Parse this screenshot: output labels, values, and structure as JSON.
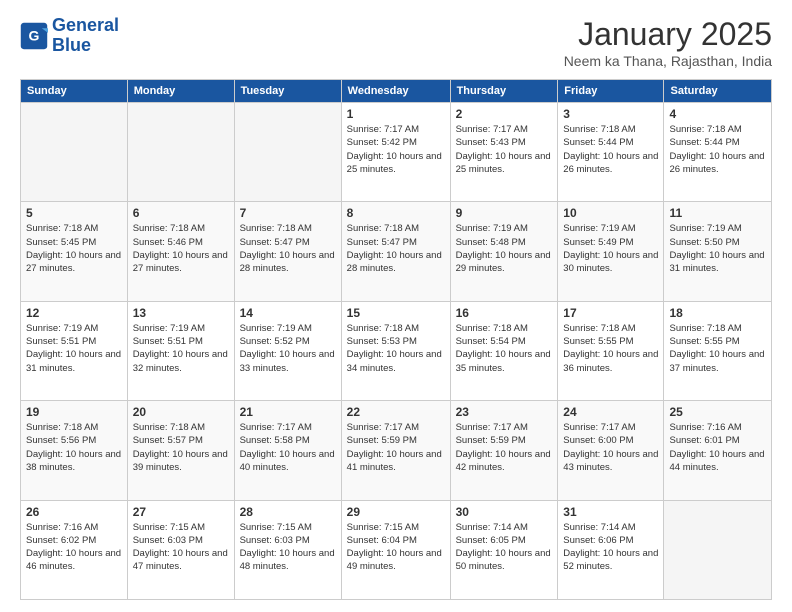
{
  "header": {
    "logo_line1": "General",
    "logo_line2": "Blue",
    "month": "January 2025",
    "location": "Neem ka Thana, Rajasthan, India"
  },
  "weekdays": [
    "Sunday",
    "Monday",
    "Tuesday",
    "Wednesday",
    "Thursday",
    "Friday",
    "Saturday"
  ],
  "weeks": [
    [
      {
        "day": "",
        "sunrise": "",
        "sunset": "",
        "daylight": ""
      },
      {
        "day": "",
        "sunrise": "",
        "sunset": "",
        "daylight": ""
      },
      {
        "day": "",
        "sunrise": "",
        "sunset": "",
        "daylight": ""
      },
      {
        "day": "1",
        "sunrise": "7:17 AM",
        "sunset": "5:42 PM",
        "daylight": "10 hours and 25 minutes."
      },
      {
        "day": "2",
        "sunrise": "7:17 AM",
        "sunset": "5:43 PM",
        "daylight": "10 hours and 25 minutes."
      },
      {
        "day": "3",
        "sunrise": "7:18 AM",
        "sunset": "5:44 PM",
        "daylight": "10 hours and 26 minutes."
      },
      {
        "day": "4",
        "sunrise": "7:18 AM",
        "sunset": "5:44 PM",
        "daylight": "10 hours and 26 minutes."
      }
    ],
    [
      {
        "day": "5",
        "sunrise": "7:18 AM",
        "sunset": "5:45 PM",
        "daylight": "10 hours and 27 minutes."
      },
      {
        "day": "6",
        "sunrise": "7:18 AM",
        "sunset": "5:46 PM",
        "daylight": "10 hours and 27 minutes."
      },
      {
        "day": "7",
        "sunrise": "7:18 AM",
        "sunset": "5:47 PM",
        "daylight": "10 hours and 28 minutes."
      },
      {
        "day": "8",
        "sunrise": "7:18 AM",
        "sunset": "5:47 PM",
        "daylight": "10 hours and 28 minutes."
      },
      {
        "day": "9",
        "sunrise": "7:19 AM",
        "sunset": "5:48 PM",
        "daylight": "10 hours and 29 minutes."
      },
      {
        "day": "10",
        "sunrise": "7:19 AM",
        "sunset": "5:49 PM",
        "daylight": "10 hours and 30 minutes."
      },
      {
        "day": "11",
        "sunrise": "7:19 AM",
        "sunset": "5:50 PM",
        "daylight": "10 hours and 31 minutes."
      }
    ],
    [
      {
        "day": "12",
        "sunrise": "7:19 AM",
        "sunset": "5:51 PM",
        "daylight": "10 hours and 31 minutes."
      },
      {
        "day": "13",
        "sunrise": "7:19 AM",
        "sunset": "5:51 PM",
        "daylight": "10 hours and 32 minutes."
      },
      {
        "day": "14",
        "sunrise": "7:19 AM",
        "sunset": "5:52 PM",
        "daylight": "10 hours and 33 minutes."
      },
      {
        "day": "15",
        "sunrise": "7:18 AM",
        "sunset": "5:53 PM",
        "daylight": "10 hours and 34 minutes."
      },
      {
        "day": "16",
        "sunrise": "7:18 AM",
        "sunset": "5:54 PM",
        "daylight": "10 hours and 35 minutes."
      },
      {
        "day": "17",
        "sunrise": "7:18 AM",
        "sunset": "5:55 PM",
        "daylight": "10 hours and 36 minutes."
      },
      {
        "day": "18",
        "sunrise": "7:18 AM",
        "sunset": "5:55 PM",
        "daylight": "10 hours and 37 minutes."
      }
    ],
    [
      {
        "day": "19",
        "sunrise": "7:18 AM",
        "sunset": "5:56 PM",
        "daylight": "10 hours and 38 minutes."
      },
      {
        "day": "20",
        "sunrise": "7:18 AM",
        "sunset": "5:57 PM",
        "daylight": "10 hours and 39 minutes."
      },
      {
        "day": "21",
        "sunrise": "7:17 AM",
        "sunset": "5:58 PM",
        "daylight": "10 hours and 40 minutes."
      },
      {
        "day": "22",
        "sunrise": "7:17 AM",
        "sunset": "5:59 PM",
        "daylight": "10 hours and 41 minutes."
      },
      {
        "day": "23",
        "sunrise": "7:17 AM",
        "sunset": "5:59 PM",
        "daylight": "10 hours and 42 minutes."
      },
      {
        "day": "24",
        "sunrise": "7:17 AM",
        "sunset": "6:00 PM",
        "daylight": "10 hours and 43 minutes."
      },
      {
        "day": "25",
        "sunrise": "7:16 AM",
        "sunset": "6:01 PM",
        "daylight": "10 hours and 44 minutes."
      }
    ],
    [
      {
        "day": "26",
        "sunrise": "7:16 AM",
        "sunset": "6:02 PM",
        "daylight": "10 hours and 46 minutes."
      },
      {
        "day": "27",
        "sunrise": "7:15 AM",
        "sunset": "6:03 PM",
        "daylight": "10 hours and 47 minutes."
      },
      {
        "day": "28",
        "sunrise": "7:15 AM",
        "sunset": "6:03 PM",
        "daylight": "10 hours and 48 minutes."
      },
      {
        "day": "29",
        "sunrise": "7:15 AM",
        "sunset": "6:04 PM",
        "daylight": "10 hours and 49 minutes."
      },
      {
        "day": "30",
        "sunrise": "7:14 AM",
        "sunset": "6:05 PM",
        "daylight": "10 hours and 50 minutes."
      },
      {
        "day": "31",
        "sunrise": "7:14 AM",
        "sunset": "6:06 PM",
        "daylight": "10 hours and 52 minutes."
      },
      {
        "day": "",
        "sunrise": "",
        "sunset": "",
        "daylight": ""
      }
    ]
  ],
  "labels": {
    "sunrise": "Sunrise:",
    "sunset": "Sunset:",
    "daylight": "Daylight:"
  }
}
